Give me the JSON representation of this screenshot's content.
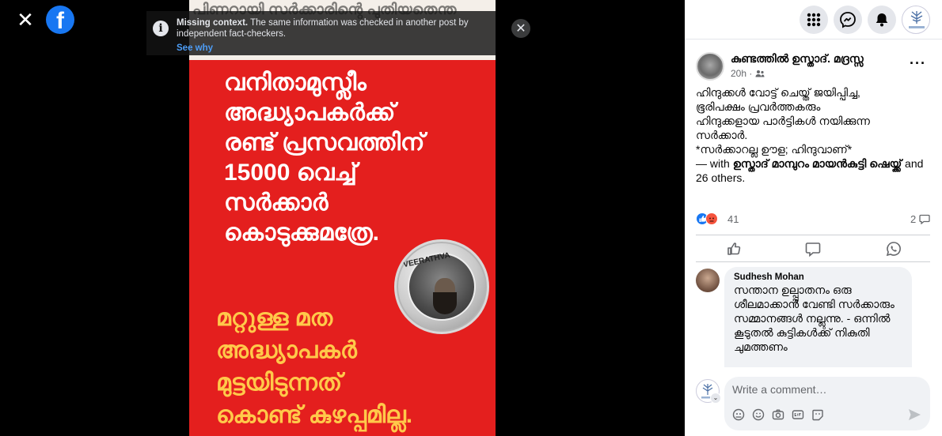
{
  "viewer": {
    "close_glyph": "✕",
    "fb_logo_letter": "f",
    "poster": {
      "top_strip_text": "പിണറായി സർക്കാരിന്റെ പുതിയതെന്ത",
      "main_lines": [
        "വനിതാമുസ്ലീം",
        "അദ്ധ്യാപകർക്ക്",
        "രണ്ട് പ്രസവത്തിന്",
        "15000 വെച്ച്",
        "സർക്കാർ",
        "കൊടുക്കുമത്രേ."
      ],
      "bottom_lines": [
        "മറ്റുള്ള മത",
        "അദ്ധ്യാപകർ",
        "മുട്ടയിടുന്നത്",
        "കൊണ്ട് കുഴപ്പമില്ല."
      ],
      "seal_text": "VEERATHVA"
    },
    "fact_check": {
      "icon_glyph": "i",
      "title": "Missing context.",
      "text": " The same information was checked in another post by independent fact-checkers.",
      "see_why": "See why",
      "close_glyph": "✕"
    }
  },
  "panel": {
    "top_icons": [
      "menu-grid-icon",
      "messenger-icon",
      "notifications-bell-icon",
      "profile-avatar"
    ],
    "post": {
      "author": "കുണ്ടത്തിൽ ഉസ്താദ്. മദ്രസ്സ",
      "time": "20h · ",
      "audience_icon": "friends-icon",
      "more_glyph": "···",
      "text_lines": [
        "ഹിന്ദുക്കൾ വോട്ട് ചെയ്ത് ജയിപ്പിച്ച,",
        "ഭൂരിപക്ഷം പ്രവർത്തകരും",
        "ഹിന്ദുക്കളായ പാർട്ടികൾ നയിക്കുന്ന",
        "സർക്കാർ.",
        "*സർക്കാറല്ല ഊള; ഹിന്ദുവാണ്*"
      ],
      "with_prefix": "— with ",
      "with_name": "ഉസ്താദ് മാമ്പുറം മായൻകുട്ടി ഷെയ്ക്ക്",
      "with_suffix": " and 26 others.",
      "reaction_count": "41",
      "comment_count": "2"
    },
    "actions": [
      "like-icon",
      "comment-icon",
      "whatsapp-icon"
    ],
    "comment": {
      "author": "Sudhesh Mohan",
      "text": "സന്താന ഉല്പ്പാതനം ഒരു ശീലമാക്കാൻ വേണ്ടി സർക്കാരും സമ്മാനങ്ങൾ നല്ലുന്നു. - ഒന്നിൽ കൂടുതൽ കുട്ടികൾക്ക് നികുതി ചുമത്തണം"
    },
    "composer": {
      "placeholder": "Write a comment…",
      "icons": [
        "avatar-sticker-icon",
        "emoji-icon",
        "camera-icon",
        "gif-icon",
        "sticker-icon"
      ],
      "chevron_glyph": "⌄"
    }
  },
  "colors": {
    "poster_red": "#e41f1e",
    "poster_yellow": "#ffc94a",
    "facebook_blue": "#1877f2",
    "link_blue": "#4d9df6"
  }
}
